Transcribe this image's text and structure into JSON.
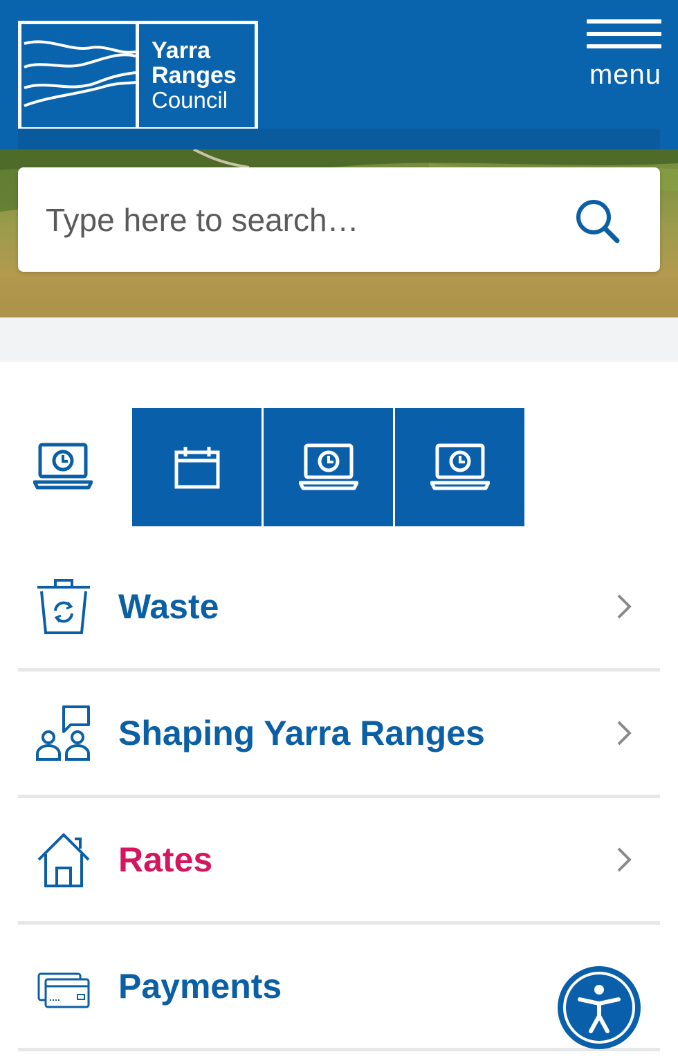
{
  "header": {
    "logo_line1": "Yarra",
    "logo_line2": "Ranges",
    "logo_line3": "Council",
    "menu_label": "menu"
  },
  "search": {
    "placeholder": "Type here to search…"
  },
  "quick_links": {
    "icons": [
      "laptop-clock-icon",
      "calendar-icon",
      "laptop-clock-icon",
      "laptop-clock-icon"
    ]
  },
  "list": {
    "items": [
      {
        "label": "Waste",
        "icon": "recycle-bin-icon",
        "active": false
      },
      {
        "label": "Shaping Yarra Ranges",
        "icon": "community-chat-icon",
        "active": false
      },
      {
        "label": "Rates",
        "icon": "house-icon",
        "active": true
      },
      {
        "label": "Payments",
        "icon": "payment-cards-icon",
        "active": false
      }
    ]
  },
  "colors": {
    "brand_blue": "#0a63ad",
    "tile_blue": "#0a5fab",
    "active_pink": "#d6155f",
    "divider": "#e6e7e8"
  }
}
